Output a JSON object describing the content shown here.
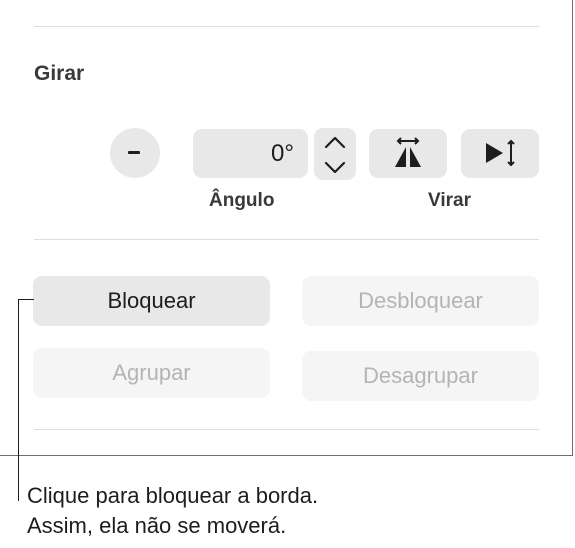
{
  "rotate": {
    "title": "Girar",
    "angle_value": "0°",
    "angle_label": "Ângulo",
    "flip_label": "Virar",
    "dial_icon": "rotate-dial-icon",
    "stepper_up_icon": "chevron-up-icon",
    "stepper_down_icon": "chevron-down-icon",
    "flip_horizontal_icon": "flip-horizontal-icon",
    "flip_vertical_icon": "flip-vertical-icon"
  },
  "actions": {
    "lock_label": "Bloquear",
    "unlock_label": "Desbloquear",
    "group_label": "Agrupar",
    "ungroup_label": "Desagrupar"
  },
  "callout": {
    "line1": "Clique para bloquear a borda.",
    "line2": "Assim, ela não se moverá."
  },
  "colors": {
    "control_bg": "#e8e8e8",
    "disabled_bg": "#f5f5f5",
    "disabled_text": "#b4b4b4",
    "text": "#1d1d1f"
  }
}
